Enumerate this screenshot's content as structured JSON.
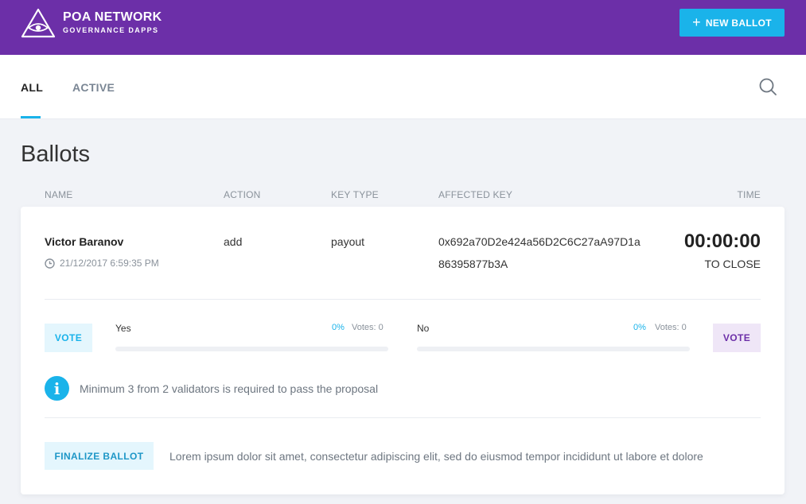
{
  "header": {
    "brand_title": "POA NETWORK",
    "brand_subtitle": "GOVERNANCE DAPPS",
    "logo_icon": "eye-triangle-icon",
    "new_ballot_label": "NEW BALLOT",
    "plus_icon": "+"
  },
  "tabs": [
    {
      "label": "ALL",
      "selected": true
    },
    {
      "label": "ACTIVE",
      "selected": false
    }
  ],
  "page_title": "Ballots",
  "columns": [
    "NAME",
    "ACTION",
    "KEY TYPE",
    "AFFECTED KEY",
    "TIME"
  ],
  "ballot": {
    "name": "Victor Baranov",
    "date": "21/12/2017 6:59:35 PM",
    "action": "add",
    "key_type": "payout",
    "affected_key_line1": "0x692a70D2e424a56D2C6C27aA97D1a",
    "affected_key_line2": "86395877b3A",
    "timer": "00:00:00",
    "timer_label": "TO CLOSE",
    "yes": {
      "vote_label": "VOTE",
      "option": "Yes",
      "percent": "0%",
      "votes": "Votes: 0",
      "progress": 0
    },
    "no": {
      "vote_label": "VOTE",
      "option": "No",
      "percent": "0%",
      "votes": "Votes: 0",
      "progress": 0
    },
    "info_icon": "i",
    "info_text": "Minimum 3 from 2 validators is required to pass the proposal",
    "finalize_label": "FINALIZE BALLOT",
    "description": "Lorem ipsum dolor sit amet, consectetur adipiscing elit, sed do eiusmod tempor incididunt ut labore et dolore"
  },
  "colors": {
    "header_bg": "#6c2fa8",
    "accent": "#1ab3ea",
    "page_bg": "#f1f3f7"
  }
}
